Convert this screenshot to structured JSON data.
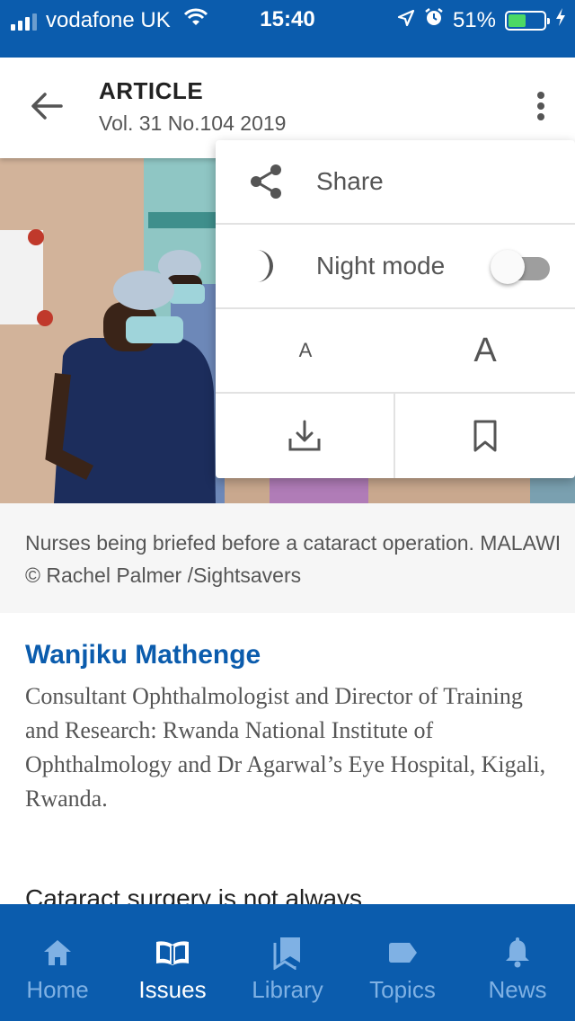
{
  "status_bar": {
    "carrier": "vodafone UK",
    "time": "15:40",
    "battery": "51%",
    "battery_level": 0.51,
    "colors": {
      "background": "#0b5cad",
      "battery_fill": "#4cd964"
    }
  },
  "app_bar": {
    "title": "ARTICLE",
    "subtitle": "Vol. 31 No.104 2019",
    "back_icon": "arrow-left-icon",
    "more_icon": "more-vertical-icon"
  },
  "overflow_menu": {
    "share_label": "Share",
    "night_mode_label": "Night mode",
    "night_mode_enabled": false,
    "font_small_label": "A",
    "font_large_label": "A",
    "icons": [
      "share-icon",
      "moon-icon",
      "download-icon",
      "bookmark-icon"
    ]
  },
  "article": {
    "caption": "Nurses being briefed before a cataract operation. MALAWI © Rachel Palmer /Sightsavers",
    "author": "Wanjiku Mathenge",
    "author_bio": "Consultant Ophthalmologist and Director of Training and Research: Rwanda National Institute of Ophthalmology and Dr Agarwal’s Eye Hospital, Kigali, Rwanda.",
    "body_start": "Cataract surgery is not always"
  },
  "bottom_nav": {
    "items": [
      {
        "label": "Home",
        "icon": "home-icon"
      },
      {
        "label": "Issues",
        "icon": "open-book-icon",
        "active": true
      },
      {
        "label": "Library",
        "icon": "library-icon"
      },
      {
        "label": "Topics",
        "icon": "tag-icon"
      },
      {
        "label": "News",
        "icon": "bell-icon"
      }
    ],
    "colors": {
      "background": "#0b5cad",
      "active": "#ffffff",
      "inactive": "#7fb1e4"
    }
  }
}
